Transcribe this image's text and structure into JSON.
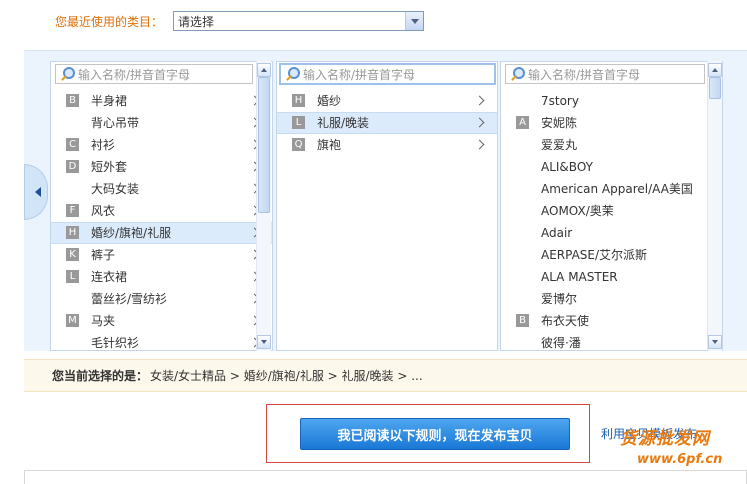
{
  "recent": {
    "label": "您最近使用的类目：",
    "selected": "请选择"
  },
  "search_placeholder": "输入名称/拼音首字母",
  "col1": {
    "items": [
      {
        "letter": "B",
        "name": "半身裙"
      },
      {
        "letter": "",
        "name": "背心吊带"
      },
      {
        "letter": "C",
        "name": "衬衫"
      },
      {
        "letter": "D",
        "name": "短外套"
      },
      {
        "letter": "",
        "name": "大码女装"
      },
      {
        "letter": "F",
        "name": "风衣"
      },
      {
        "letter": "H",
        "name": "婚纱/旗袍/礼服",
        "selected": true
      },
      {
        "letter": "K",
        "name": "裤子"
      },
      {
        "letter": "L",
        "name": "连衣裙"
      },
      {
        "letter": "",
        "name": "蕾丝衫/雪纺衫"
      },
      {
        "letter": "M",
        "name": "马夹"
      },
      {
        "letter": "",
        "name": "毛针织衫"
      }
    ]
  },
  "col2": {
    "items": [
      {
        "letter": "H",
        "name": "婚纱"
      },
      {
        "letter": "L",
        "name": "礼服/晚装",
        "selected": true
      },
      {
        "letter": "Q",
        "name": "旗袍"
      }
    ]
  },
  "col3": {
    "items": [
      {
        "letter": "",
        "name": "7story"
      },
      {
        "letter": "A",
        "name": "安妮陈"
      },
      {
        "letter": "",
        "name": "爱爱丸"
      },
      {
        "letter": "",
        "name": "ALI&BOY"
      },
      {
        "letter": "",
        "name": "American Apparel/AA美国"
      },
      {
        "letter": "",
        "name": "AOMOX/奥茉"
      },
      {
        "letter": "",
        "name": "Adair"
      },
      {
        "letter": "",
        "name": "AERPASE/艾尔派斯"
      },
      {
        "letter": "",
        "name": "ALA MASTER"
      },
      {
        "letter": "",
        "name": "爱博尔"
      },
      {
        "letter": "B",
        "name": "布衣天使"
      },
      {
        "letter": "",
        "name": "彼得·潘"
      }
    ]
  },
  "crumb": {
    "label": "您当前选择的是：",
    "path": "女装/女士精品 > 婚纱/旗袍/礼服 > 礼服/晚装 > ..."
  },
  "publish_button": "我已阅读以下规则，现在发布宝贝",
  "template_link": "利用宝贝模板发布",
  "watermark": {
    "line1": "货源批发网",
    "line2": "www.6pf.cn"
  }
}
